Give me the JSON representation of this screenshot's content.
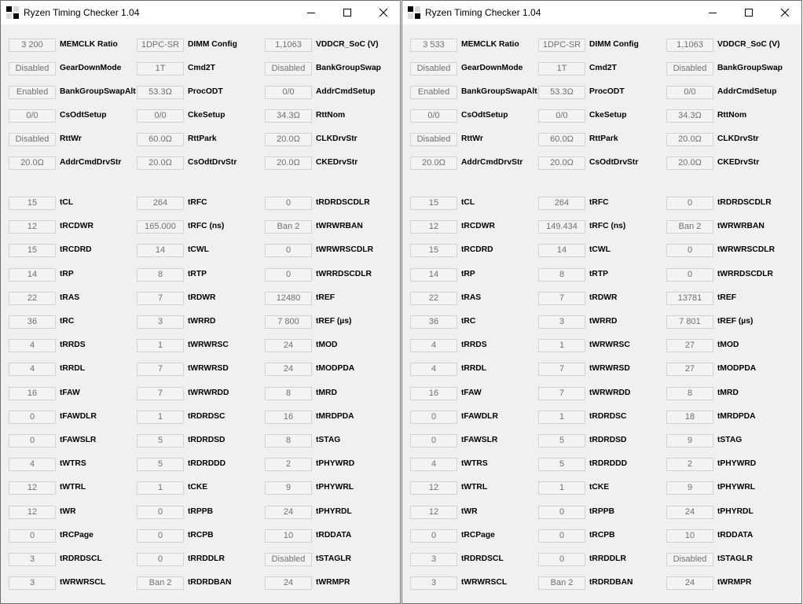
{
  "labels": {
    "config": [
      [
        "MEMCLK Ratio",
        "DIMM Config",
        "VDDCR_SoC (V)"
      ],
      [
        "GearDownMode",
        "Cmd2T",
        "BankGroupSwap"
      ],
      [
        "BankGroupSwapAlt",
        "ProcODT",
        "AddrCmdSetup"
      ],
      [
        "CsOdtSetup",
        "CkeSetup",
        "RttNom"
      ],
      [
        "RttWr",
        "RttPark",
        "CLKDrvStr"
      ],
      [
        "AddrCmdDrvStr",
        "CsOdtDrvStr",
        "CKEDrvStr"
      ]
    ],
    "timings": [
      [
        "tCL",
        "tRFC",
        "tRDRDSCDLR"
      ],
      [
        "tRCDWR",
        "tRFC (ns)",
        "tWRWRBAN"
      ],
      [
        "tRCDRD",
        "tCWL",
        "tWRWRSCDLR"
      ],
      [
        "tRP",
        "tRTP",
        "tWRRDSCDLR"
      ],
      [
        "tRAS",
        "tRDWR",
        "tREF"
      ],
      [
        "tRC",
        "tWRRD",
        "tREF (µs)"
      ],
      [
        "tRRDS",
        "tWRWRSC",
        "tMOD"
      ],
      [
        "tRRDL",
        "tWRWRSD",
        "tMODPDA"
      ],
      [
        "tFAW",
        "tWRWRDD",
        "tMRD"
      ],
      [
        "tFAWDLR",
        "tRDRDSC",
        "tMRDPDA"
      ],
      [
        "tFAWSLR",
        "tRDRDSD",
        "tSTAG"
      ],
      [
        "tWTRS",
        "tRDRDDD",
        "tPHYWRD"
      ],
      [
        "tWTRL",
        "tCKE",
        "tPHYWRL"
      ],
      [
        "tWR",
        "tRPPB",
        "tPHYRDL"
      ],
      [
        "tRCPage",
        "tRCPB",
        "tRDDATA"
      ],
      [
        "tRDRDSCL",
        "tRRDDLR",
        "tSTAGLR"
      ],
      [
        "tWRWRSCL",
        "tRDRDBAN",
        "tWRMPR"
      ]
    ]
  },
  "windows": [
    {
      "title": "Ryzen Timing Checker 1.04",
      "config_values": [
        [
          "3 200",
          "1DPC-SR",
          "1,1063"
        ],
        [
          "Disabled",
          "1T",
          "Disabled"
        ],
        [
          "Enabled",
          "53.3Ω",
          "0/0"
        ],
        [
          "0/0",
          "0/0",
          "34.3Ω"
        ],
        [
          "Disabled",
          "60.0Ω",
          "20.0Ω"
        ],
        [
          "20.0Ω",
          "20.0Ω",
          "20.0Ω"
        ]
      ],
      "timing_values": [
        [
          "15",
          "264",
          "0"
        ],
        [
          "12",
          "165.000",
          "Ban 2"
        ],
        [
          "15",
          "14",
          "0"
        ],
        [
          "14",
          "8",
          "0"
        ],
        [
          "22",
          "7",
          "12480"
        ],
        [
          "36",
          "3",
          "7 800"
        ],
        [
          "4",
          "1",
          "24"
        ],
        [
          "4",
          "7",
          "24"
        ],
        [
          "16",
          "7",
          "8"
        ],
        [
          "0",
          "1",
          "16"
        ],
        [
          "0",
          "5",
          "8"
        ],
        [
          "4",
          "5",
          "2"
        ],
        [
          "12",
          "1",
          "9"
        ],
        [
          "12",
          "0",
          "24"
        ],
        [
          "0",
          "0",
          "10"
        ],
        [
          "3",
          "0",
          "Disabled"
        ],
        [
          "3",
          "Ban 2",
          "24"
        ]
      ]
    },
    {
      "title": "Ryzen Timing Checker 1.04",
      "config_values": [
        [
          "3 533",
          "1DPC-SR",
          "1,1063"
        ],
        [
          "Disabled",
          "1T",
          "Disabled"
        ],
        [
          "Enabled",
          "53.3Ω",
          "0/0"
        ],
        [
          "0/0",
          "0/0",
          "34.3Ω"
        ],
        [
          "Disabled",
          "60.0Ω",
          "20.0Ω"
        ],
        [
          "20.0Ω",
          "20.0Ω",
          "20.0Ω"
        ]
      ],
      "timing_values": [
        [
          "15",
          "264",
          "0"
        ],
        [
          "12",
          "149.434",
          "Ban 2"
        ],
        [
          "15",
          "14",
          "0"
        ],
        [
          "14",
          "8",
          "0"
        ],
        [
          "22",
          "7",
          "13781"
        ],
        [
          "36",
          "3",
          "7 801"
        ],
        [
          "4",
          "1",
          "27"
        ],
        [
          "4",
          "7",
          "27"
        ],
        [
          "16",
          "7",
          "8"
        ],
        [
          "0",
          "1",
          "18"
        ],
        [
          "0",
          "5",
          "9"
        ],
        [
          "4",
          "5",
          "2"
        ],
        [
          "12",
          "1",
          "9"
        ],
        [
          "12",
          "0",
          "24"
        ],
        [
          "0",
          "0",
          "10"
        ],
        [
          "3",
          "0",
          "Disabled"
        ],
        [
          "3",
          "Ban 2",
          "24"
        ]
      ]
    }
  ],
  "icons": {
    "app": "app-icon",
    "minimize": "minimize-icon",
    "maximize": "maximize-icon",
    "close": "close-icon"
  }
}
